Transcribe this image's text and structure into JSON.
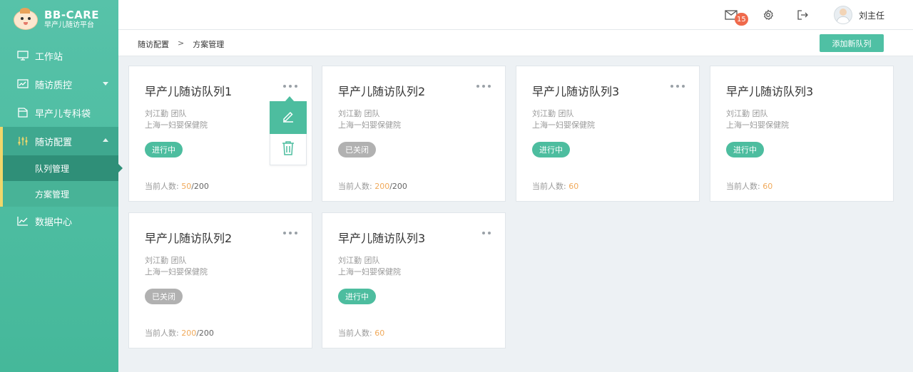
{
  "brand": {
    "title": "BB-CARE",
    "subtitle": "早产儿随访平台"
  },
  "sidebar": {
    "items": [
      {
        "label": "工作站",
        "icon": "monitor-icon"
      },
      {
        "label": "随访质控",
        "icon": "chart-board-icon"
      },
      {
        "label": "早产儿专科袋",
        "icon": "folder-icon"
      },
      {
        "label": "随访配置",
        "icon": "sliders-icon"
      },
      {
        "label": "数据中心",
        "icon": "line-chart-icon"
      }
    ],
    "subitems": [
      {
        "label": "队列管理",
        "selected": true
      },
      {
        "label": "方案管理",
        "selected": false
      }
    ]
  },
  "header": {
    "mail_badge": "15",
    "user_name": "刘主任"
  },
  "breadcrumb": {
    "parent": "随访配置",
    "separator": ">",
    "current": "方案管理"
  },
  "actions": {
    "add_label": "添加新队列"
  },
  "cards": [
    {
      "title": "早产儿随访队列1",
      "owner": "刘江勤 团队",
      "hospital": "上海一妇婴保健院",
      "status": "进行中",
      "status_type": "on",
      "count_label": "当前人数:",
      "count": "50",
      "total": "/200"
    },
    {
      "title": "早产儿随访队列2",
      "owner": "刘江勤 团队",
      "hospital": "上海一妇婴保健院",
      "status": "已关闭",
      "status_type": "off",
      "count_label": "当前人数:",
      "count": "200",
      "total": "/200"
    },
    {
      "title": "早产儿随访队列3",
      "owner": "刘江勤 团队",
      "hospital": "上海一妇婴保健院",
      "status": "进行中",
      "status_type": "on",
      "count_label": "当前人数:",
      "count": "60",
      "total": ""
    },
    {
      "title": "早产儿随访队列3",
      "owner": "刘江勤 团队",
      "hospital": "上海一妇婴保健院",
      "status": "进行中",
      "status_type": "on",
      "count_label": "当前人数:",
      "count": "60",
      "total": ""
    },
    {
      "title": "早产儿随访队列2",
      "owner": "刘江勤 团队",
      "hospital": "上海一妇婴保健院",
      "status": "已关闭",
      "status_type": "off",
      "count_label": "当前人数:",
      "count": "200",
      "total": "/200"
    },
    {
      "title": "早产儿随访队列3",
      "owner": "刘江勤 团队",
      "hospital": "上海一妇婴保健院",
      "status": "进行中",
      "status_type": "on",
      "count_label": "当前人数:",
      "count": "60",
      "total": ""
    }
  ],
  "colors": {
    "primary": "#4dbd9f",
    "sidebar": "#52bfa5",
    "accent_orange": "#f0a95a",
    "badge": "#ef6a4c",
    "closed": "#b1b1b1"
  }
}
